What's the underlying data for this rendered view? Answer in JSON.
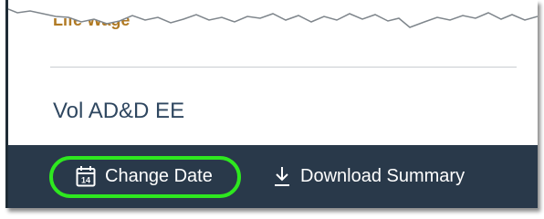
{
  "card": {
    "top_link": "Life Wage",
    "plan_title": "Vol AD&D EE"
  },
  "actions": {
    "change_date": {
      "label": "Change Date",
      "icon": "calendar-14-icon",
      "icon_text": "14"
    },
    "download_summary": {
      "label": "Download Summary",
      "icon": "download-icon"
    }
  },
  "colors": {
    "action_bar": "#29394a",
    "title_text": "#2f4760",
    "link_text": "#b07a24",
    "highlight": "#2ee81f"
  }
}
